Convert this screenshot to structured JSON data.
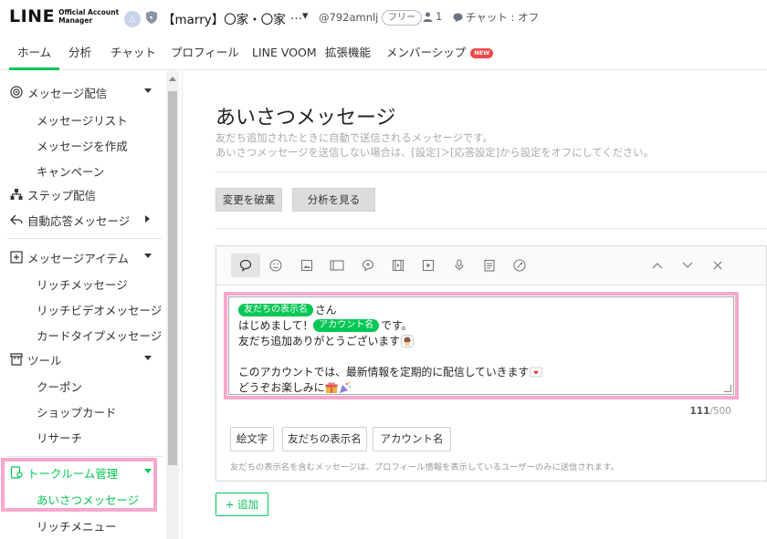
{
  "header": {
    "logo_main": "LINE",
    "logo_sub": "Official Account Manager",
    "account_avatar_initial": "△",
    "account_name": "【marry】〇家・〇家",
    "account_more": "…▾",
    "account_id": "@792amnlj",
    "plan_badge": "フリー",
    "friends_count": "1",
    "chat_status": "チャット : オフ"
  },
  "tabs": [
    {
      "label": "ホーム",
      "active": true
    },
    {
      "label": "分析"
    },
    {
      "label": "チャット"
    },
    {
      "label": "プロフィール"
    },
    {
      "label": "LINE VOOM"
    },
    {
      "label": "拡張機能"
    },
    {
      "label": "メンバーシップ",
      "badge": "NEW"
    }
  ],
  "sidebar": {
    "groups": [
      {
        "label": "メッセージ配信",
        "icon": "broadcast-icon",
        "items": [
          "メッセージリスト",
          "メッセージを作成",
          "キャンペーン"
        ]
      },
      {
        "label": "ステップ配信",
        "icon": "step-icon"
      },
      {
        "label": "自動応答メッセージ",
        "icon": "auto-reply-icon"
      },
      {
        "label": "メッセージアイテム",
        "icon": "message-item-icon",
        "items": [
          "リッチメッセージ",
          "リッチビデオメッセージ",
          "カードタイプメッセージ"
        ]
      },
      {
        "label": "ツール",
        "icon": "tools-icon",
        "items": [
          "クーポン",
          "ショップカード",
          "リサーチ"
        ]
      },
      {
        "label": "トークルーム管理",
        "icon": "talkroom-icon",
        "items": [
          "あいさつメッセージ",
          "リッチメニュー"
        ]
      }
    ]
  },
  "main": {
    "title": "あいさつメッセージ",
    "desc1": "友だち追加されたときに自動で送信されるメッセージです。",
    "desc2": "あいさつメッセージを送信しない場合は、[設定]＞[応答設定]から設定をオフにしてください。",
    "discard_label": "変更を破棄",
    "analysis_label": "分析を見る",
    "message": {
      "line1_tag": "友だちの表示名",
      "line1_text": "さん",
      "line2_pre": "はじめまして！",
      "line2_tag": "アカウント名",
      "line2_post": "です。",
      "line3": "友だち追加ありがとうございます",
      "line5": "このアカウントでは、最新情報を定期的に配信していきます",
      "line6": "どうぞお楽しみに"
    },
    "counter_current": "111",
    "counter_max": "/500",
    "insert_emoji": "絵文字",
    "insert_friend_name": "友だちの表示名",
    "insert_account_name": "アカウント名",
    "note": "友だちの表示名を含むメッセージは、プロフィール情報を表示しているユーザーのみに送信されます。",
    "add_label": "追加",
    "add_plus": "+"
  },
  "colors": {
    "accent_green": "#06c755",
    "highlight_pink": "#f7a8cc",
    "new_badge": "#f0484a"
  }
}
